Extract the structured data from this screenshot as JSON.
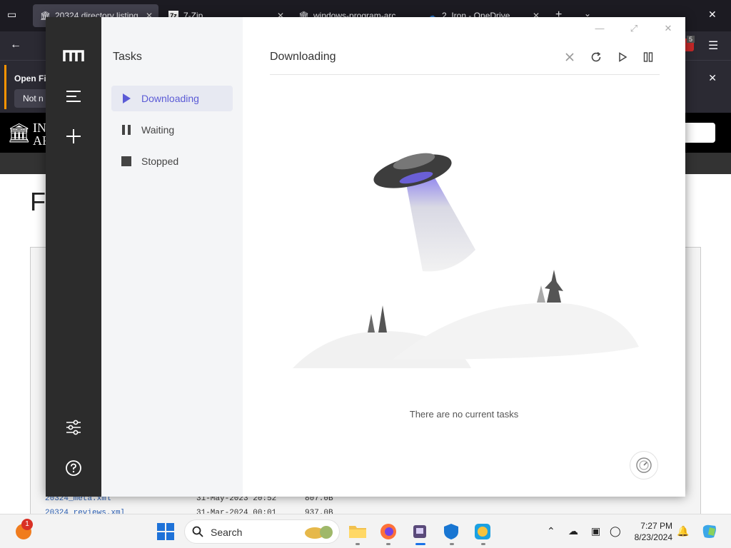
{
  "browser": {
    "tabs": [
      {
        "title": "20324 directory listing",
        "icon": "archive-icon",
        "active": true
      },
      {
        "title": "7-Zip",
        "icon": "seven-zip-icon"
      },
      {
        "title": "windows-program-arc",
        "icon": "archive-icon"
      },
      {
        "title": "2. Iron - OneDrive",
        "icon": "onedrive-icon"
      }
    ],
    "notification": {
      "title": "Open Fi",
      "button": "Not n"
    },
    "extension_badge": "5",
    "site_logo_line1": "IN",
    "site_logo_line2": "AR",
    "page_heading": "F",
    "listing": [
      {
        "name": "20324_meta.xml",
        "date": "31-May-2023 20:52",
        "size": "807.0B"
      },
      {
        "name": "20324_reviews.xml",
        "date": "31-Mar-2024 00:01",
        "size": "937.0B"
      }
    ]
  },
  "app": {
    "name": "Motrix",
    "sidebar_title": "Tasks",
    "nav": [
      {
        "label": "Downloading",
        "icon": "play-icon",
        "active": true
      },
      {
        "label": "Waiting",
        "icon": "pause-icon",
        "active": false
      },
      {
        "label": "Stopped",
        "icon": "stop-icon",
        "active": false
      }
    ],
    "main_title": "Downloading",
    "empty_message": "There are no current tasks",
    "accent_color": "#5b5bd6"
  },
  "taskbar": {
    "search_placeholder": "Search",
    "time": "7:27 PM",
    "date": "8/23/2024",
    "notification_count": "1"
  }
}
